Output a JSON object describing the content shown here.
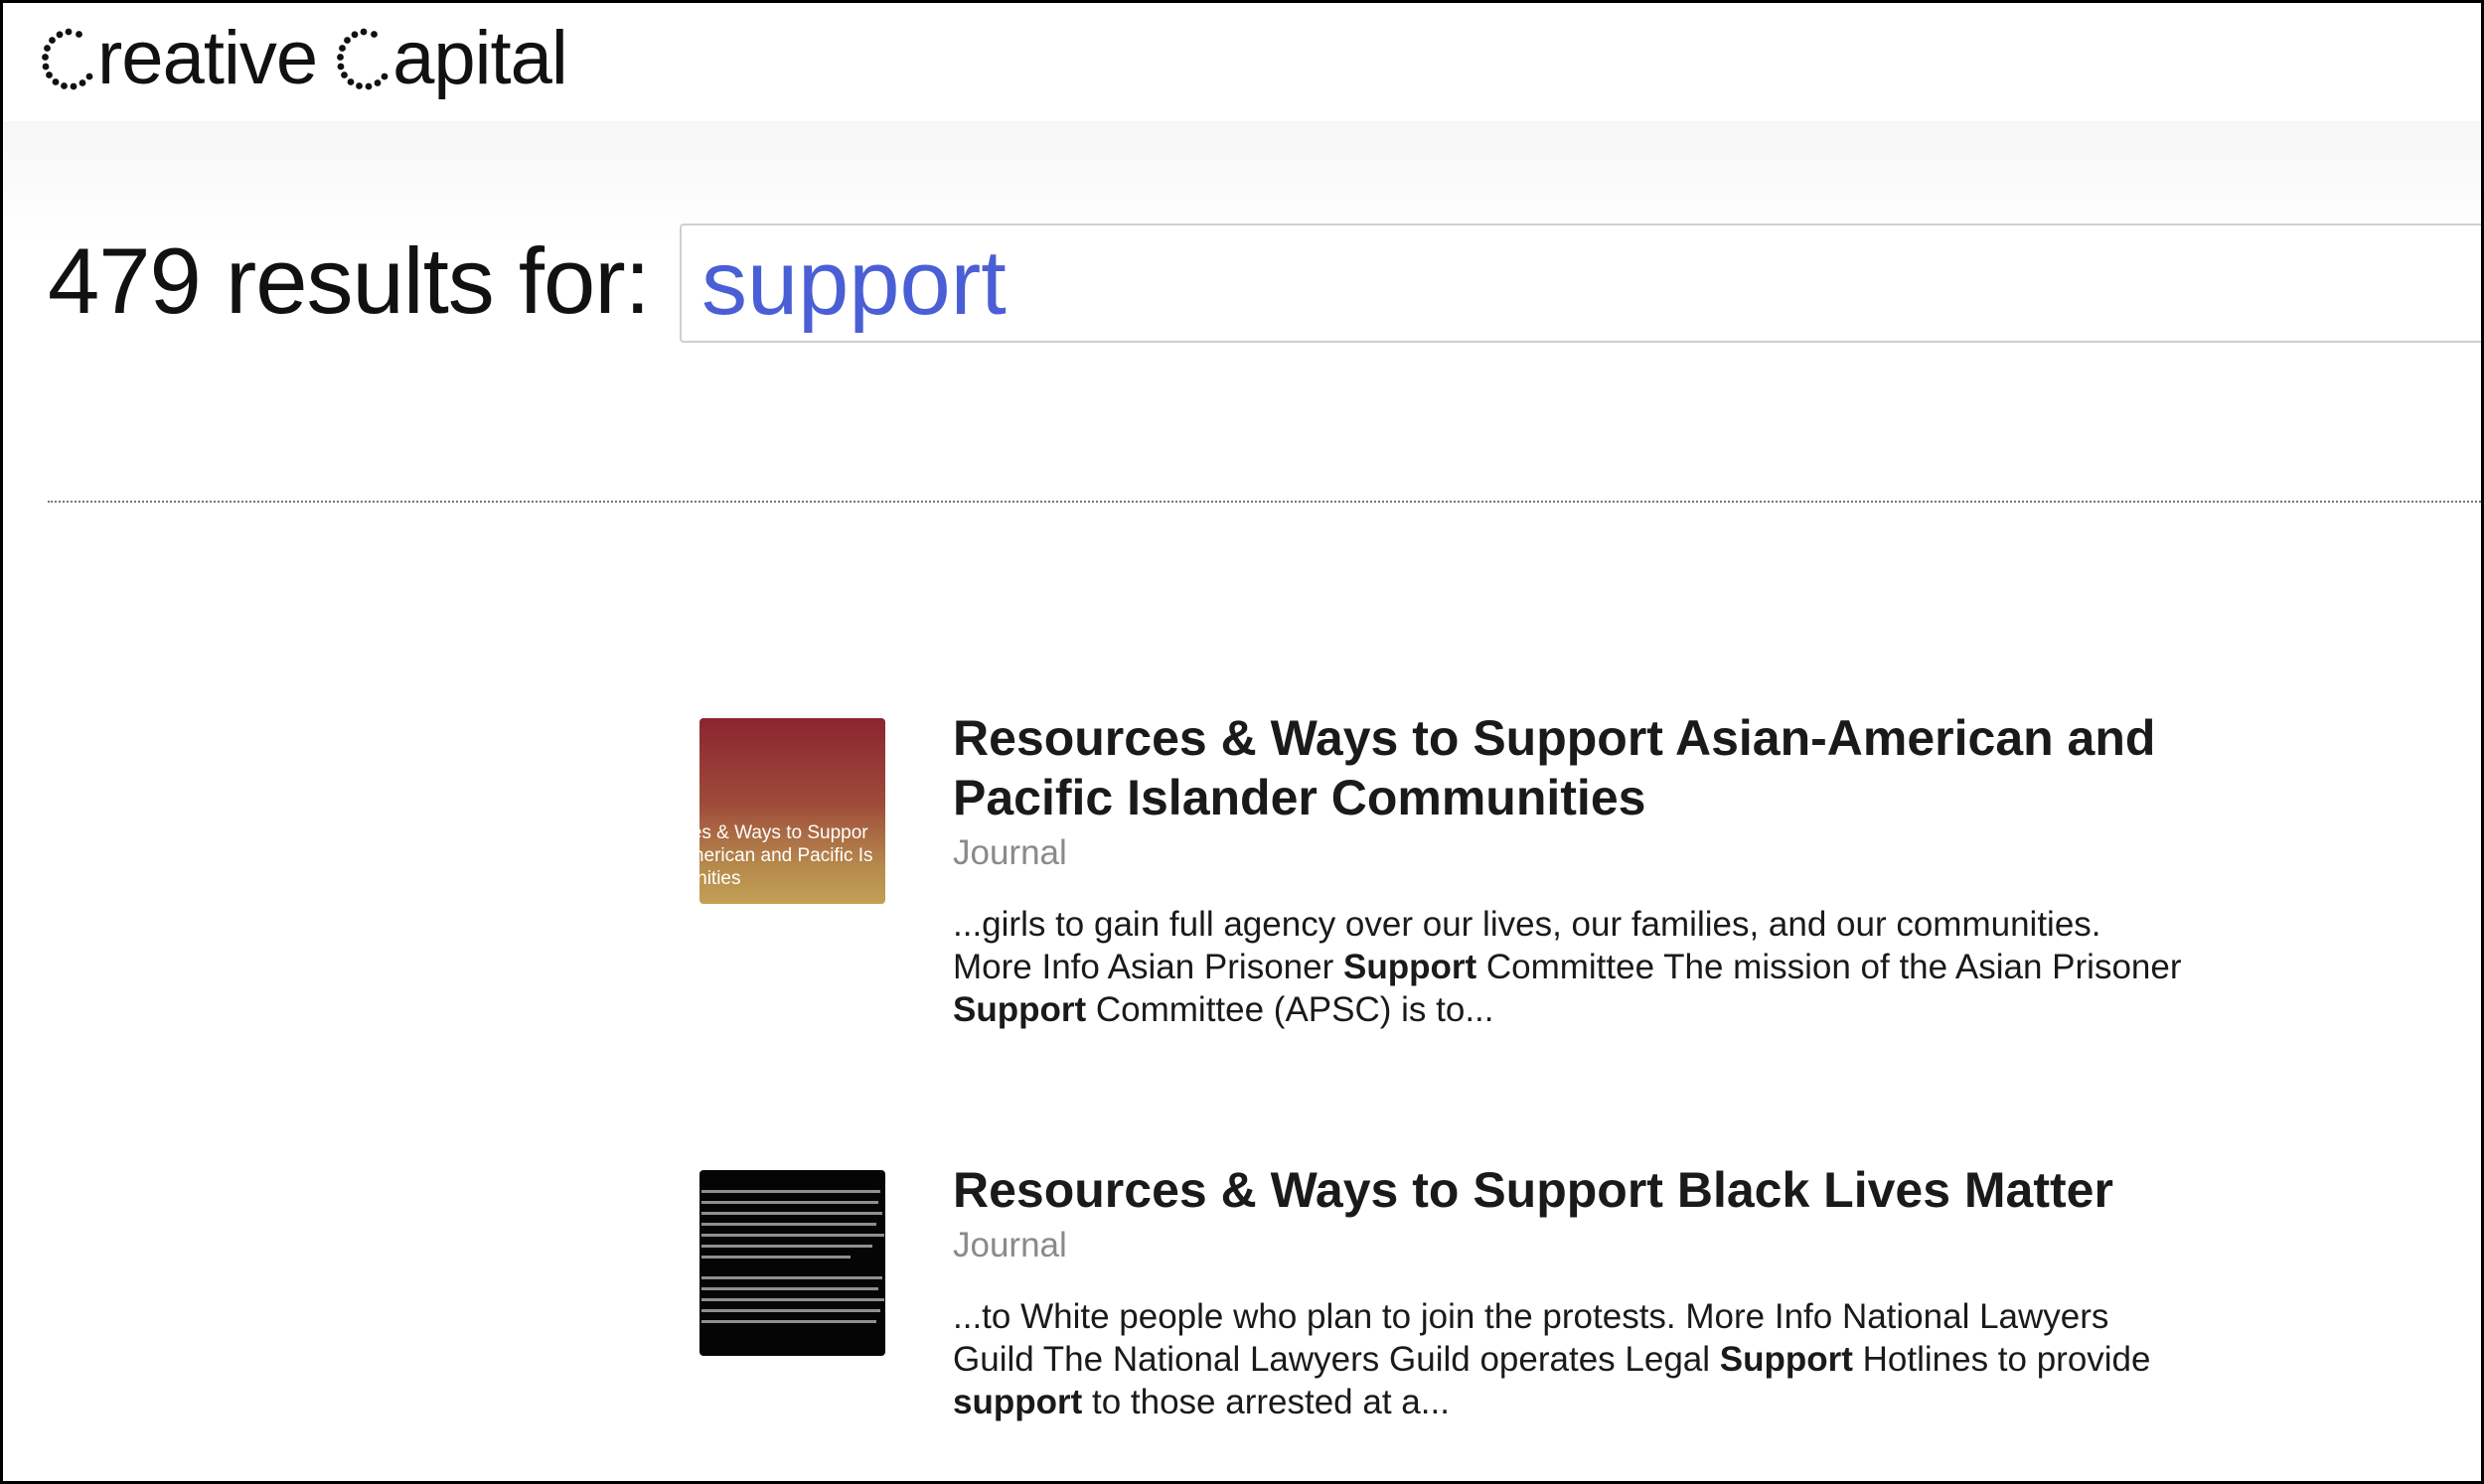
{
  "brand": {
    "word1_rest": "reative",
    "word2_rest": "apital",
    "logo_alt": "Creative Capital"
  },
  "search": {
    "results_label": "479 results for:",
    "query": "support"
  },
  "results": [
    {
      "title": "Resources & Ways to Support Asian-American and Pacific Islander Communities",
      "title_line1": "Resources & Ways to Support Asian-American and",
      "title_line2": "Pacific Islander Communities",
      "type": "Journal",
      "thumb_text_1": "rces & Ways to Suppor",
      "thumb_text_2": "American and Pacific Is",
      "thumb_text_3": "nunities",
      "excerpt_parts": [
        "...girls to gain full agency over our lives, our families, and our communities. More Info Asian Prisoner ",
        "Support",
        " Committee The mission of the Asian Prisoner ",
        "Support",
        " Committee (APSC) is to..."
      ]
    },
    {
      "title": "Resources & Ways to Support Black Lives Matter",
      "type": "Journal",
      "excerpt_parts": [
        "...to White people who plan to join the protests. More Info National Lawyers Guild The National Lawyers Guild operates Legal ",
        "Support",
        " Hotlines to provide ",
        "support",
        " to those arrested at a..."
      ]
    }
  ],
  "colors": {
    "query_text": "#4a5fd6",
    "meta_text": "#8a8a8a"
  }
}
